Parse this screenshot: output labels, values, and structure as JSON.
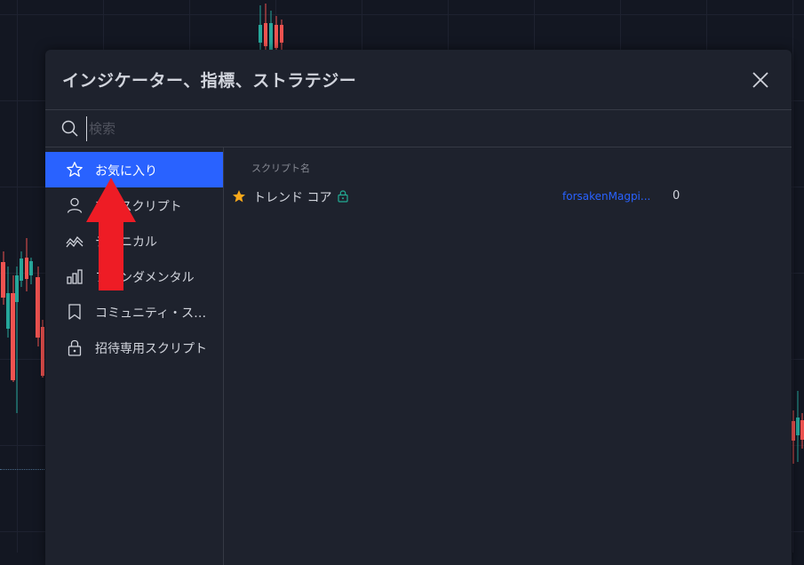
{
  "dialog": {
    "title": "インジケーター、指標、ストラテジー"
  },
  "search": {
    "placeholder": "検索",
    "value": ""
  },
  "sidebar": {
    "items": [
      {
        "label": "お気に入り",
        "icon": "star-icon",
        "active": true
      },
      {
        "label": "マイスクリプト",
        "icon": "user-icon",
        "active": false
      },
      {
        "label": "テクニカル",
        "icon": "technical-chart-icon",
        "active": false
      },
      {
        "label": "ファンダメンタル",
        "icon": "bar-chart-icon",
        "active": false
      },
      {
        "label": "コミュニティ・スク...",
        "icon": "bookmark-icon",
        "active": false
      },
      {
        "label": "招待専用スクリプト",
        "icon": "lock-icon",
        "active": false
      }
    ]
  },
  "main": {
    "column_header": "スクリプト名",
    "rows": [
      {
        "name": "トレンド コア",
        "author": "forsakenMagpi...",
        "count": "0",
        "favorite": true,
        "locked": true
      }
    ]
  },
  "colors": {
    "accent": "#2962ff",
    "star": "#f7a81b",
    "lock": "#22ab94",
    "annotation_arrow": "#ee1c25"
  }
}
